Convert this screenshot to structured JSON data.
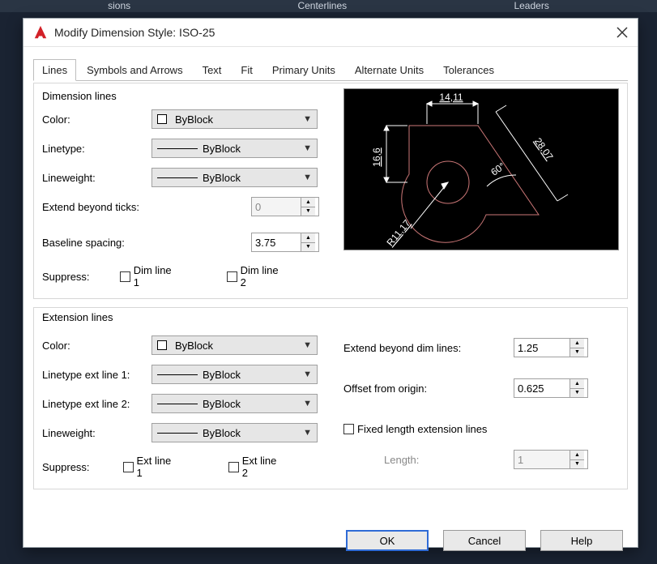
{
  "ribbon": {
    "left": "sions",
    "center": "Centerlines",
    "right": "Leaders"
  },
  "dialog": {
    "title": "Modify Dimension Style: ISO-25",
    "tabs": [
      "Lines",
      "Symbols and Arrows",
      "Text",
      "Fit",
      "Primary Units",
      "Alternate Units",
      "Tolerances"
    ],
    "active_tab": 0
  },
  "dim_lines": {
    "group": "Dimension lines",
    "color_label": "Color:",
    "color_value": "ByBlock",
    "linetype_label": "Linetype:",
    "linetype_value": "ByBlock",
    "lineweight_label": "Lineweight:",
    "lineweight_value": "ByBlock",
    "extend_ticks_label": "Extend beyond ticks:",
    "extend_ticks_value": "0",
    "baseline_label": "Baseline spacing:",
    "baseline_value": "3.75",
    "suppress_label": "Suppress:",
    "suppress_a": "Dim line 1",
    "suppress_b": "Dim line 2"
  },
  "ext_lines": {
    "group": "Extension lines",
    "color_label": "Color:",
    "color_value": "ByBlock",
    "lt1_label": "Linetype ext line 1:",
    "lt1_value": "ByBlock",
    "lt2_label": "Linetype ext line 2:",
    "lt2_value": "ByBlock",
    "lw_label": "Lineweight:",
    "lw_value": "ByBlock",
    "suppress_label": "Suppress:",
    "suppress_a": "Ext line 1",
    "suppress_b": "Ext line 2",
    "ext_beyond_label": "Extend beyond dim lines:",
    "ext_beyond_value": "1.25",
    "offset_label": "Offset from origin:",
    "offset_value": "0.625",
    "fixed_label": "Fixed length extension lines",
    "length_label": "Length:",
    "length_value": "1"
  },
  "preview": {
    "dim_top": "14,11",
    "dim_left": "16,6",
    "dim_diag": "28,07",
    "dim_angle": "60°",
    "dim_radius": "R11,17"
  },
  "buttons": {
    "ok": "OK",
    "cancel": "Cancel",
    "help": "Help"
  }
}
